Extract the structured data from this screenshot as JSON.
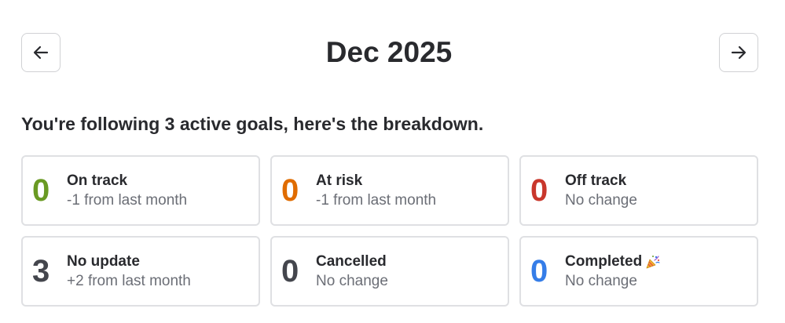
{
  "header": {
    "month_title": "Dec 2025",
    "prev_icon": "arrow-left-icon",
    "next_icon": "arrow-right-icon"
  },
  "summary": {
    "text": "You're following 3 active goals, here's the breakdown."
  },
  "cards": [
    {
      "count": "0",
      "label": "On track",
      "delta": "-1 from last month",
      "color": "#6a9a23"
    },
    {
      "count": "0",
      "label": "At risk",
      "delta": "-1 from last month",
      "color": "#e06c00"
    },
    {
      "count": "0",
      "label": "Off track",
      "delta": "No change",
      "color": "#c9372c"
    },
    {
      "count": "3",
      "label": "No update",
      "delta": "+2 from last month",
      "color": "#44464d"
    },
    {
      "count": "0",
      "label": "Cancelled",
      "delta": "No change",
      "color": "#44464d"
    },
    {
      "count": "0",
      "label": "Completed",
      "delta": "No change",
      "color": "#357de8",
      "icon": "party-popper-icon"
    }
  ]
}
